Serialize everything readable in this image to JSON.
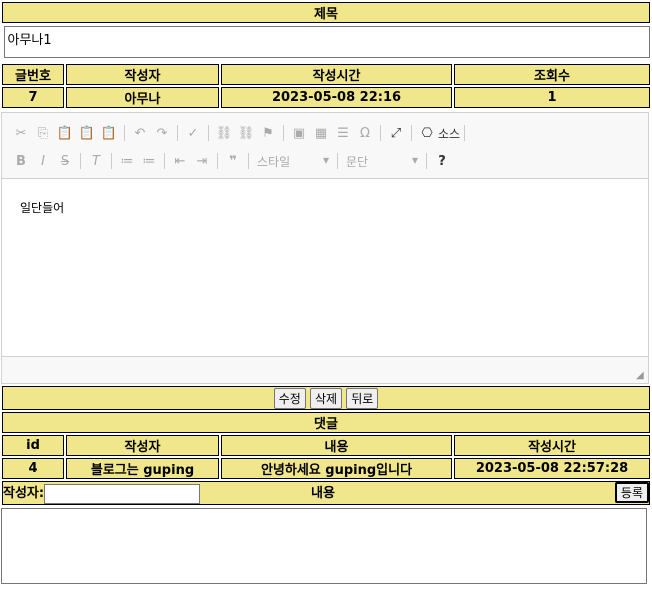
{
  "post": {
    "title_header": "제목",
    "title_value": "아무나1",
    "columns": [
      "글번호",
      "작성자",
      "작성시간",
      "조회수"
    ],
    "values": [
      "7",
      "아무나",
      "2023-05-08 22:16",
      "1"
    ],
    "content": "일단들어"
  },
  "editor": {
    "source_label": "소스",
    "style_label": "스타일",
    "paragraph_label": "문단"
  },
  "actions": {
    "edit": "수정",
    "delete": "삭제",
    "back": "뒤로"
  },
  "comments": {
    "header": "댓글",
    "columns": [
      "id",
      "작성자",
      "내용",
      "작성시간"
    ],
    "rows": [
      {
        "id": "4",
        "author": "블로그는 guping",
        "content": "안녕하세요 guping입니다",
        "time": "2023-05-08 22:57:28"
      }
    ],
    "author_label": "작성자:",
    "content_label": "내용",
    "submit_label": "등록"
  }
}
